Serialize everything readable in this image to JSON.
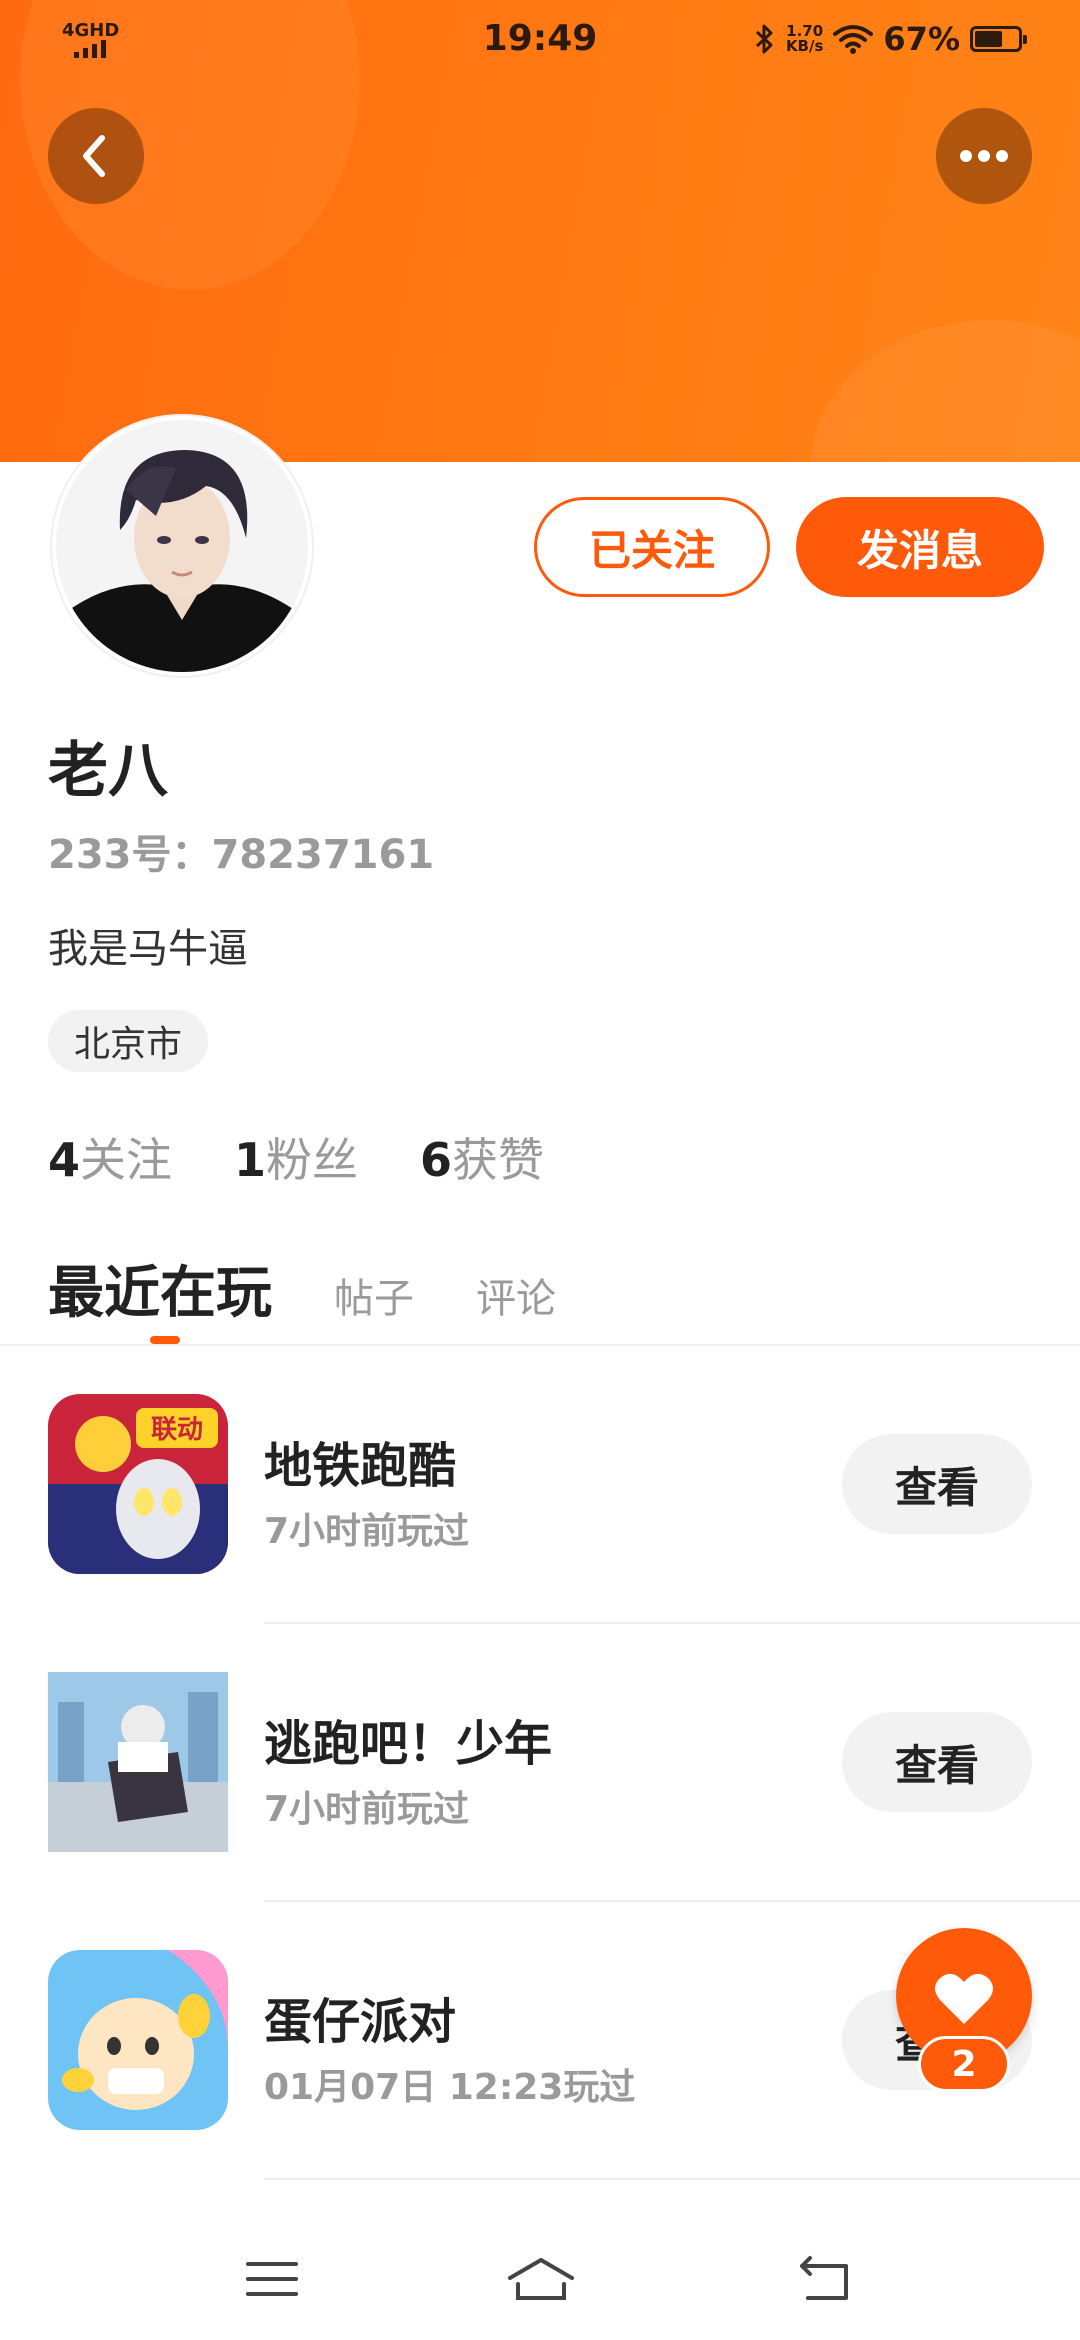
{
  "status_bar": {
    "network": "4GHD",
    "time": "19:49",
    "speed_value": "1.70",
    "speed_unit": "KB/s",
    "battery_percent": "67%",
    "battery_level": 0.67
  },
  "header": {
    "back_icon": "chevron-left-icon",
    "more_icon": "more-dots-icon"
  },
  "profile": {
    "name": "老八",
    "id_text": "233号：78237161",
    "bio": "我是马牛逼",
    "location": "北京市",
    "follow_button": "已关注",
    "message_button": "发消息",
    "stats": [
      {
        "num": "4",
        "label": "关注"
      },
      {
        "num": "1",
        "label": "粉丝"
      },
      {
        "num": "6",
        "label": "获赞"
      }
    ]
  },
  "tabs": [
    {
      "label": "最近在玩",
      "active": true
    },
    {
      "label": "帖子",
      "active": false
    },
    {
      "label": "评论",
      "active": false
    }
  ],
  "games": [
    {
      "name": "地铁跑酷",
      "time": "7小时前玩过",
      "button": "查看",
      "icon_text": "联动"
    },
    {
      "name": "逃跑吧！少年",
      "time": "7小时前玩过",
      "button": "查看"
    },
    {
      "name": "蛋仔派对",
      "time": "01月07日 12:23玩过",
      "button": "查看"
    }
  ],
  "fab": {
    "icon": "heart-icon",
    "badge": "2"
  },
  "colors": {
    "accent": "#ff5a0a",
    "banner": "#ff7a12"
  },
  "nav": {
    "menu_icon": "menu-icon",
    "home_icon": "home-icon",
    "back_icon": "return-icon"
  }
}
